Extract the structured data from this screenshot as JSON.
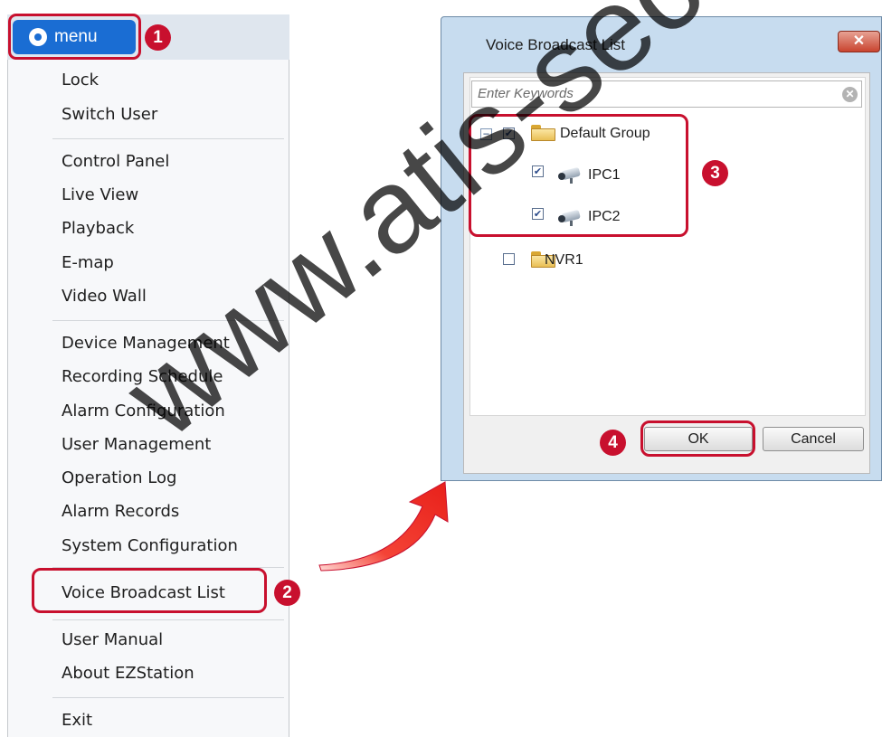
{
  "menu": {
    "button_label": "menu",
    "items": [
      "Lock",
      "Switch User",
      "Control Panel",
      "Live View",
      "Playback",
      "E-map",
      "Video Wall",
      "Device Management",
      "Recording Schedule",
      "Alarm Configuration",
      "User Management",
      "Operation Log",
      "Alarm Records",
      "System Configuration",
      "Voice Broadcast List",
      "User Manual",
      "About EZStation",
      "Exit"
    ]
  },
  "dialog": {
    "title": "Voice Broadcast List",
    "close_glyph": "✕",
    "search": {
      "placeholder": "Enter Keywords",
      "clear_glyph": "✕"
    },
    "tree": {
      "group": {
        "label": "Default Group",
        "expander": "−",
        "checked": true,
        "icon": "folder-icon"
      },
      "children": [
        {
          "label": "IPC1",
          "checked": true,
          "icon": "camera-icon"
        },
        {
          "label": "IPC2",
          "checked": true,
          "icon": "camera-icon"
        }
      ],
      "nvr": {
        "label": "NVR1",
        "checked": false,
        "icon": "folder-icon"
      }
    },
    "buttons": {
      "ok": "OK",
      "cancel": "Cancel"
    }
  },
  "callouts": [
    "1",
    "2",
    "3",
    "4"
  ],
  "watermark": "www.atis-security.com",
  "colors": {
    "highlight": "#c8102e",
    "menu_button": "#1a6dd3",
    "arrow": "#e8201a"
  }
}
